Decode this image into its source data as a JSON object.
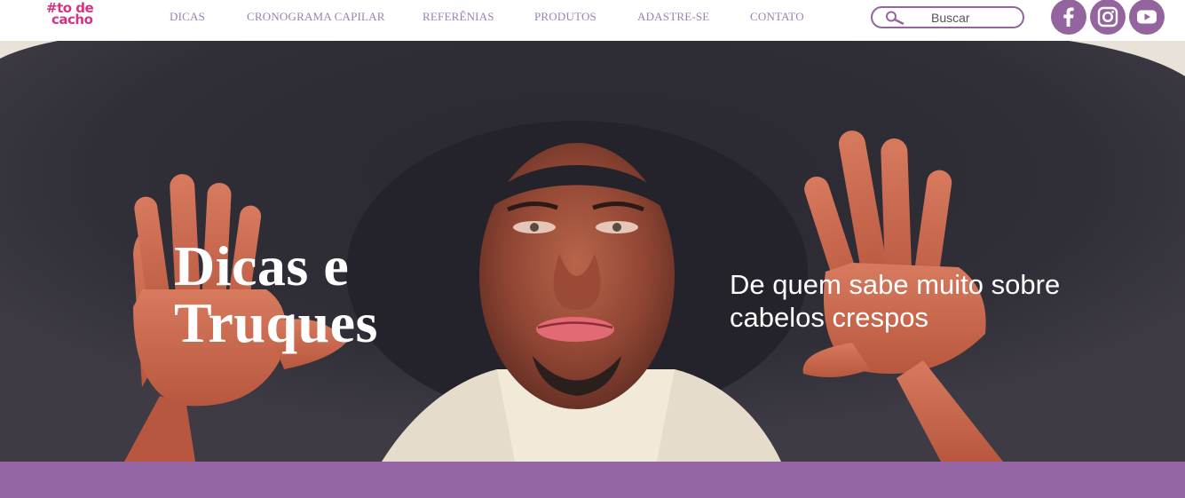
{
  "brand": {
    "logo_line1": "#to de",
    "logo_line2": "cacho"
  },
  "nav": {
    "items": [
      {
        "label": "DICAS"
      },
      {
        "label": "CRONOGRAMA CAPILAR"
      },
      {
        "label": "REFERÊNIAS"
      },
      {
        "label": "PRODUTOS"
      },
      {
        "label": "ADASTRE-SE"
      },
      {
        "label": "CONTATO"
      }
    ]
  },
  "search": {
    "placeholder": "Buscar",
    "icon": "search-icon"
  },
  "social": [
    {
      "name": "facebook",
      "icon": "facebook-icon"
    },
    {
      "name": "instagram",
      "icon": "instagram-icon"
    },
    {
      "name": "youtube",
      "icon": "youtube-icon"
    }
  ],
  "hero": {
    "title": "Dicas e Truques",
    "subtitle": "De quem sabe muito sobre cabelos crespos"
  },
  "colors": {
    "accent": "#94649f",
    "band": "#9566a6",
    "nav_text": "#9f7fb3",
    "logo": "#d63384"
  }
}
